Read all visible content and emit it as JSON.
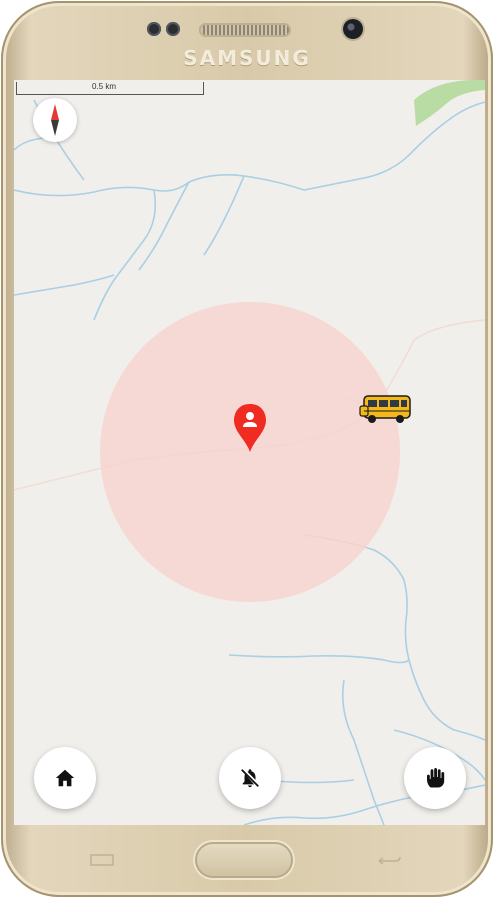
{
  "device": {
    "brand": "SAMSUNG"
  },
  "map": {
    "scale_label": "0.5 km",
    "colors": {
      "land": "#f1efeb",
      "water": "#a9cfe4",
      "park": "#b9dca4",
      "radius_fill": "#f7d3d0",
      "pin": "#ef2b22"
    },
    "markers": {
      "user_pin_icon": "user-location-pin-icon",
      "bus_icon": "school-bus-icon"
    }
  },
  "actions": {
    "home": "home-icon",
    "notifications": "bell-off-icon",
    "stop": "hand-stop-icon"
  }
}
